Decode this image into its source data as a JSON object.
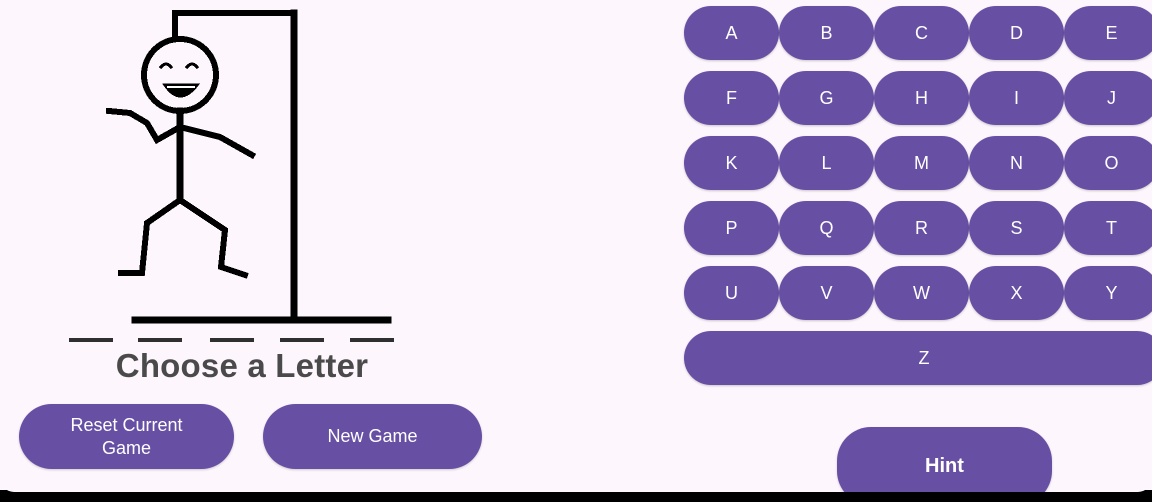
{
  "game": {
    "status_text": "Choose a Letter",
    "word_length": 5,
    "wrong_guess_stage": "full-figure"
  },
  "actions": {
    "reset_label": "Reset Current\nGame",
    "new_game_label": "New Game",
    "hint_label": "Hint"
  },
  "keyboard": {
    "rows": [
      [
        "A",
        "B",
        "C",
        "D",
        "E"
      ],
      [
        "F",
        "G",
        "H",
        "I",
        "J"
      ],
      [
        "K",
        "L",
        "M",
        "N",
        "O"
      ],
      [
        "P",
        "Q",
        "R",
        "S",
        "T"
      ],
      [
        "U",
        "V",
        "W",
        "X",
        "Y"
      ],
      [
        "Z"
      ]
    ]
  },
  "colors": {
    "button_purple": "#6750a4",
    "background": "#fdf6fd",
    "text_dark": "#4a4a4a",
    "figure_black": "#000000"
  },
  "icons": {
    "figure": "hangman-stick-figure"
  }
}
